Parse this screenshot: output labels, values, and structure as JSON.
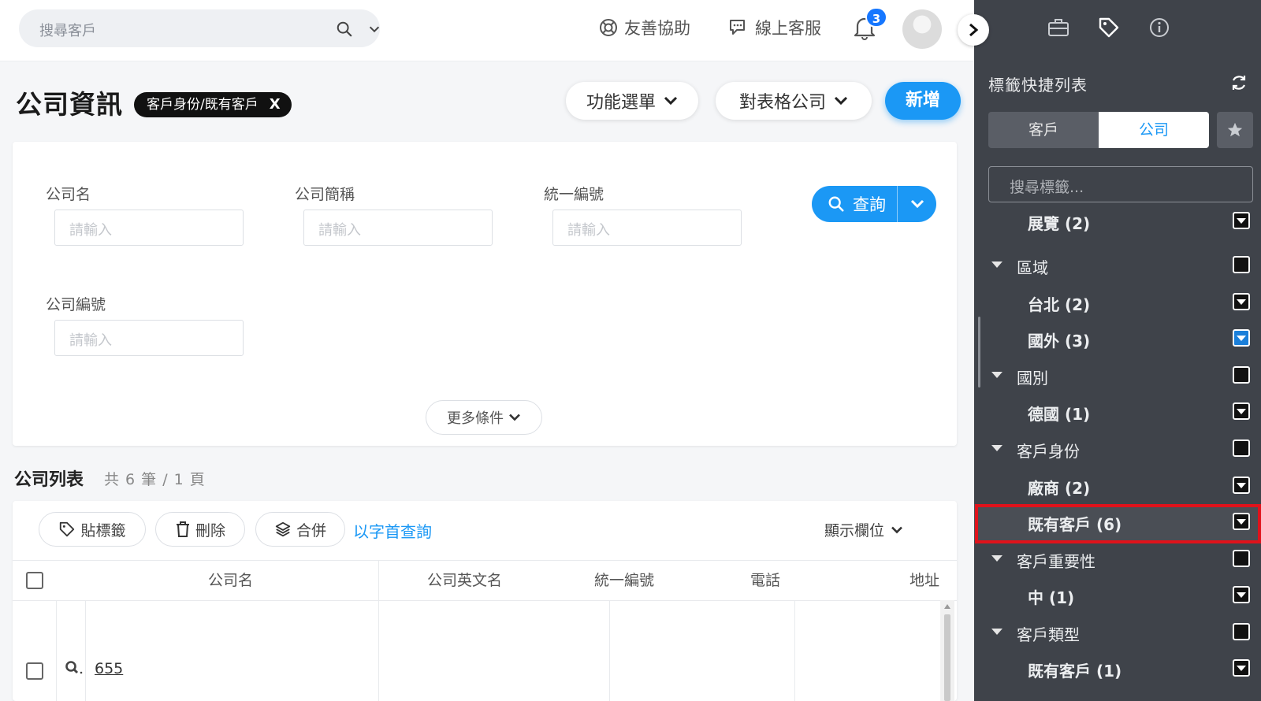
{
  "topbar": {
    "search_placeholder": "搜尋客戶",
    "help_label": "友善協助",
    "service_label": "線上客服",
    "notification_count": "3"
  },
  "page": {
    "title": "公司資訊",
    "filter_chip": "客戶身份/既有客戶",
    "filter_chip_close": "X",
    "function_menu": "功能選單",
    "table_company": "對表格公司",
    "new_button": "新增"
  },
  "search_form": {
    "fields": [
      {
        "label": "公司名",
        "placeholder": "請輸入"
      },
      {
        "label": "公司簡稱",
        "placeholder": "請輸入"
      },
      {
        "label": "統一編號",
        "placeholder": "請輸入"
      },
      {
        "label": "公司編號",
        "placeholder": "請輸入"
      }
    ],
    "query_button": "查詢",
    "more_conditions": "更多條件"
  },
  "list": {
    "title": "公司列表",
    "count_text": "共 6 筆 / 1 頁",
    "toolbar": {
      "tag": "貼標籤",
      "delete": "刪除",
      "merge": "合併",
      "initial_query": "以字首查詢",
      "show_columns": "顯示欄位"
    },
    "columns": [
      "公司名",
      "公司英文名",
      "統一編號",
      "電話",
      "地址"
    ],
    "rows": [
      {
        "company": "655"
      }
    ]
  },
  "tag_panel": {
    "title": "標籤快捷列表",
    "tabs": [
      "客戶",
      "公司"
    ],
    "active_tab": "公司",
    "search_placeholder": "搜尋標籤...",
    "tags": [
      {
        "label": "展覽 (2)",
        "type": "item",
        "checked": false
      },
      {
        "label": "區域",
        "type": "category",
        "checked": false
      },
      {
        "label": "台北 (2)",
        "type": "item",
        "checked": false
      },
      {
        "label": "國外 (3)",
        "type": "item",
        "checked": true
      },
      {
        "label": "國別",
        "type": "category",
        "checked": false
      },
      {
        "label": "德國 (1)",
        "type": "item",
        "checked": false
      },
      {
        "label": "客戶身份",
        "type": "category",
        "checked": false
      },
      {
        "label": "廠商 (2)",
        "type": "item",
        "checked": false
      },
      {
        "label": "既有客戶 (6)",
        "type": "item",
        "checked": false,
        "highlighted": true
      },
      {
        "label": "客戶重要性",
        "type": "category",
        "checked": false
      },
      {
        "label": "中 (1)",
        "type": "item",
        "checked": false
      },
      {
        "label": "客戶類型",
        "type": "category",
        "checked": false
      },
      {
        "label": "既有客戶 (1)",
        "type": "item",
        "checked": false
      }
    ]
  },
  "colors": {
    "accent": "#1b98f5",
    "panel_bg": "#3f434a",
    "highlight": "#e0121b"
  }
}
